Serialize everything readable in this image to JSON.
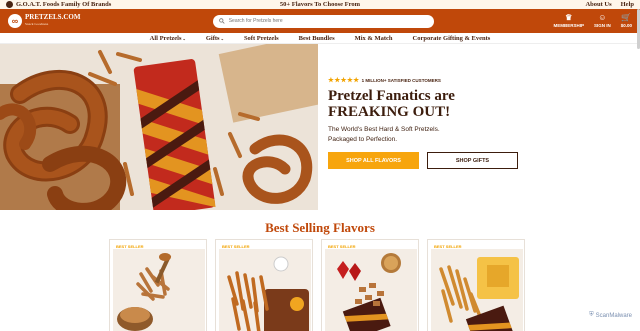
{
  "topbar": {
    "brand_family": "G.O.A.T. Foods Family Of Brands",
    "promo": "50+ Flavors To Choose From",
    "about": "About Us",
    "help": "Help"
  },
  "header": {
    "logo_text": "PRETZELS.COM",
    "logo_sub": "Snack Goodness",
    "search_placeholder": "Search for Pretzels here",
    "icons": {
      "membership": "MEMBERSHIP",
      "signin": "SIGN IN",
      "cart_total": "$0.00"
    }
  },
  "nav": {
    "items": [
      "All Pretzels",
      "Gifts",
      "Soft Pretzels",
      "Best Bundles",
      "Mix & Match",
      "Corporate Gifting & Events"
    ]
  },
  "hero": {
    "stars": "★★★★★",
    "rating_text": "1 MILLION+ SATISFIED CUSTOMERS",
    "title_line1": "Pretzel Fanatics are",
    "title_line2": "FREAKING OUT!",
    "sub_line1": "The World's Best Hard & Soft Pretzels.",
    "sub_line2": "Packaged to Perfection.",
    "btn_primary": "SHOP ALL FLAVORS",
    "btn_secondary": "SHOP GIFTS"
  },
  "best_selling": {
    "title": "Best Selling Flavors",
    "cards": [
      {
        "badge": "BEST SELLER"
      },
      {
        "badge": "BEST SELLER"
      },
      {
        "badge": "BEST SELLER"
      },
      {
        "badge": "BEST SELLER"
      }
    ]
  },
  "watermark": "ScanMalware",
  "colors": {
    "brand_orange": "#c0480a",
    "button_orange": "#f7a50d",
    "dark_brown": "#3c1d0d"
  }
}
